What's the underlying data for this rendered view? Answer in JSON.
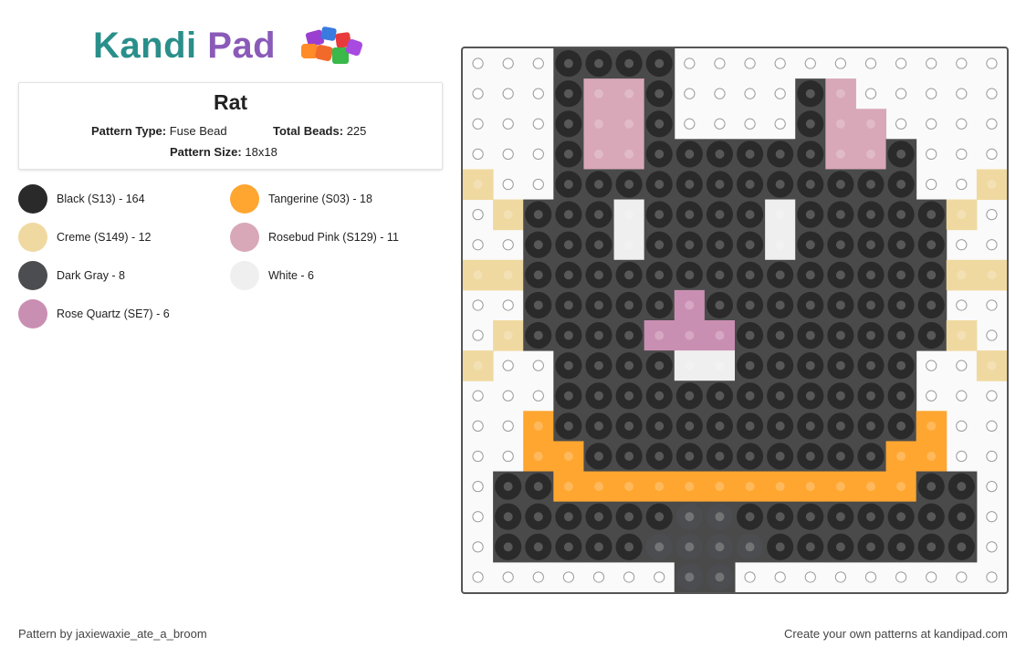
{
  "logo": {
    "part1": "Kandi",
    "part2": "Pad"
  },
  "pattern": {
    "title": "Rat",
    "type_label": "Pattern Type:",
    "type_value": "Fuse Bead",
    "total_label": "Total Beads:",
    "total_value": "225",
    "size_label": "Pattern Size:",
    "size_value": "18x18"
  },
  "legend": [
    {
      "label": "Black (S13) - 164",
      "color": "#2a2a2a"
    },
    {
      "label": "Tangerine (S03) - 18",
      "color": "#ffa630"
    },
    {
      "label": "Creme (S149) - 12",
      "color": "#f0d9a0"
    },
    {
      "label": "Rosebud Pink (S129) - 11",
      "color": "#d8a8b8"
    },
    {
      "label": "Dark Gray - 8",
      "color": "#4c4d50"
    },
    {
      "label": "White - 6",
      "color": "#efefef"
    },
    {
      "label": "Rose Quartz (SE7) - 6",
      "color": "#c98fb2"
    }
  ],
  "grid": {
    "rows": [
      "...KKKK...........",
      "...KPPK....KR.....",
      "...KPPK....KRR....",
      "...KPPKKKKKKRRK...",
      "C..KKKKKKKKKKKK..C",
      ".CKKKWKKKKWKKKKKC.",
      "..KKKWKKKKWKKKKK..",
      "CCKKKKKKKKKKKKKKCC",
      "..KKKKKQKKKKKKKK..",
      ".CKKKKQQQKKKKKKKC.",
      "C..KKKKWWKKKKKK..C",
      "...KKKKKKKKKKKK...",
      "..TKKKKKKKKKKKKT..",
      "..TTKKKKKKKKKKTT..",
      ".KKTTTTTTTTTTTTKK.",
      ".KKKKKKGGKKKKKKKK.",
      ".KKKKKGGGGKKKKKKK.",
      ".......GG........."
    ],
    "colors": {
      "K": "#2a2a2a",
      "T": "#ffa630",
      "C": "#f0d9a0",
      "P": "#d8a8b8",
      "R": "#d8a8b8",
      "Q": "#c98fb2",
      "W": "#efefef",
      "G": "#4c4d50"
    }
  },
  "footer": {
    "author": "Pattern by jaxiewaxie_ate_a_broom",
    "cta": "Create your own patterns at kandipad.com"
  }
}
